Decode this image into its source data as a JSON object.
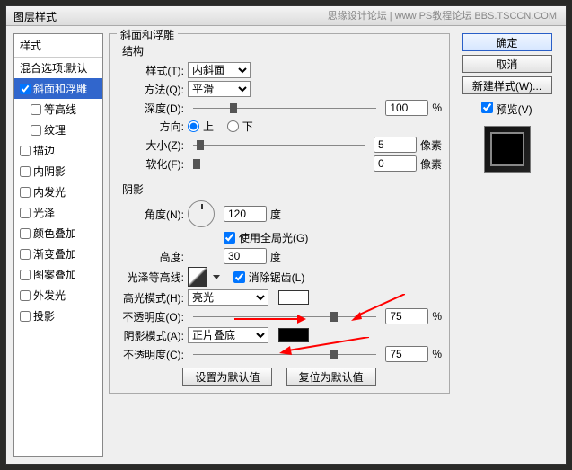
{
  "title": "图层样式",
  "watermark": "思缘设计论坛 | www PS教程论坛 BBS.TSCCN.COM",
  "sidebar": {
    "head": "样式",
    "blend": "混合选项:默认",
    "items": [
      "斜面和浮雕",
      "等高线",
      "纹理",
      "描边",
      "内阴影",
      "内发光",
      "光泽",
      "颜色叠加",
      "渐变叠加",
      "图案叠加",
      "外发光",
      "投影"
    ]
  },
  "buttons": {
    "ok": "确定",
    "cancel": "取消",
    "newStyle": "新建样式(W)...",
    "preview": "预览(V)",
    "setDefault": "设置为默认值",
    "resetDefault": "复位为默认值"
  },
  "bevel": {
    "title": "斜面和浮雕",
    "structure": "结构",
    "styleLbl": "样式(T):",
    "styleVal": "内斜面",
    "methodLbl": "方法(Q):",
    "methodVal": "平滑",
    "depthLbl": "深度(D):",
    "depthVal": "100",
    "depthUnit": "%",
    "dirLbl": "方向:",
    "up": "上",
    "down": "下",
    "sizeLbl": "大小(Z):",
    "sizeVal": "5",
    "sizeUnit": "像素",
    "softLbl": "软化(F):",
    "softVal": "0",
    "softUnit": "像素"
  },
  "shadow": {
    "title": "阴影",
    "angleLbl": "角度(N):",
    "angleVal": "120",
    "angleUnit": "度",
    "globalLight": "使用全局光(G)",
    "altLbl": "高度:",
    "altVal": "30",
    "altUnit": "度",
    "glossLbl": "光泽等高线:",
    "antialias": "消除锯齿(L)",
    "hiModeLbl": "高光模式(H):",
    "hiModeVal": "亮光",
    "opacity1Lbl": "不透明度(O):",
    "opacity1Val": "75",
    "pctUnit": "%",
    "shModeLbl": "阴影模式(A):",
    "shModeVal": "正片叠底",
    "opacity2Lbl": "不透明度(C):",
    "opacity2Val": "75"
  }
}
